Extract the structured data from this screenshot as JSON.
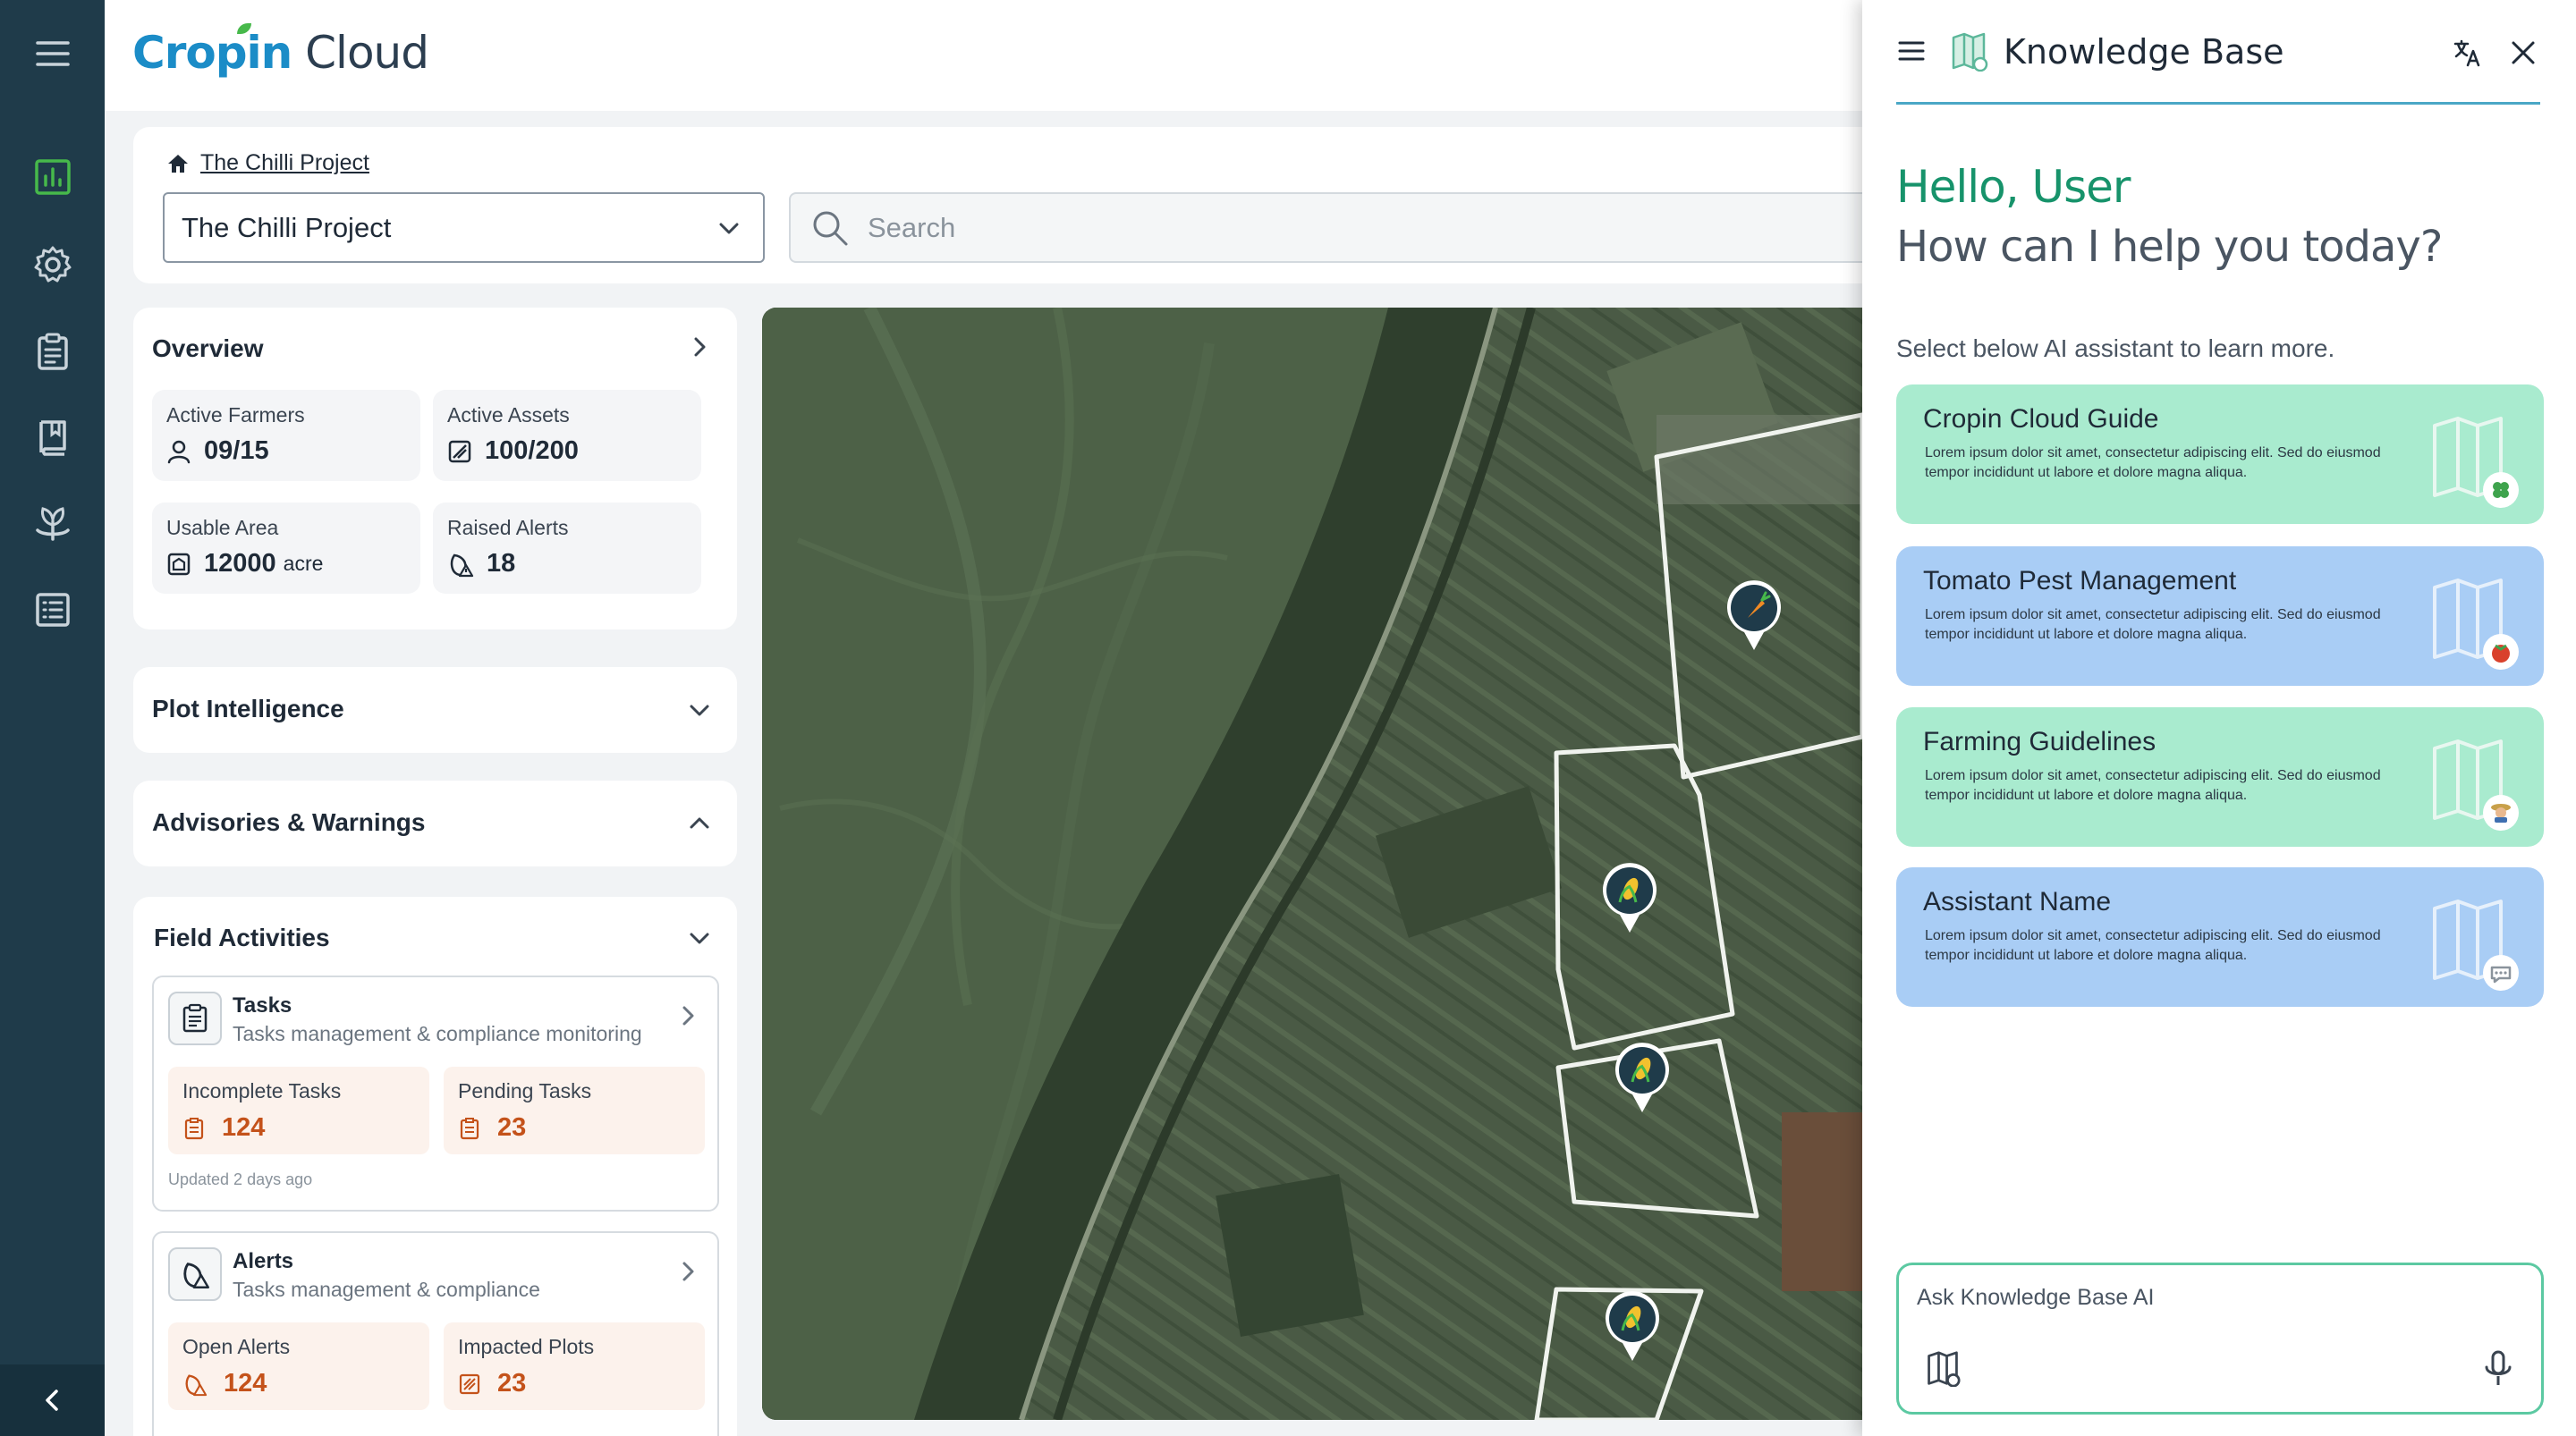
{
  "app": {
    "logo_primary": "Cropin",
    "logo_secondary": "Cloud"
  },
  "rail": {
    "items": [
      {
        "icon": "hamburger-menu-icon"
      },
      {
        "icon": "dashboard-chart-icon",
        "active": true
      },
      {
        "icon": "settings-gear-icon"
      },
      {
        "icon": "clipboard-icon"
      },
      {
        "icon": "book-icon"
      },
      {
        "icon": "plant-icon"
      },
      {
        "icon": "list-icon"
      }
    ],
    "collapse_icon": "chevron-left-icon",
    "colors": {
      "background": "#1f3b4a",
      "active": "#47b94b",
      "icon": "#c9d3da"
    }
  },
  "header": {
    "breadcrumb": "The Chilli Project",
    "project_select": "The Chilli Project",
    "search_placeholder": "Search"
  },
  "overview": {
    "title": "Overview",
    "stats": [
      {
        "label": "Active Farmers",
        "value": "09/15",
        "icon": "person-icon"
      },
      {
        "label": "Active Assets",
        "value": "100/200",
        "icon": "asset-icon"
      },
      {
        "label": "Usable Area",
        "value": "12000",
        "unit": "acre",
        "icon": "area-icon"
      },
      {
        "label": "Raised Alerts",
        "value": "18",
        "icon": "alert-leaf-icon"
      }
    ]
  },
  "sections": {
    "plot_intelligence": "Plot Intelligence",
    "advisories": "Advisories & Warnings",
    "field_activities": "Field Activities"
  },
  "activities": [
    {
      "title": "Tasks",
      "subtitle": "Tasks management & compliance monitoring",
      "metrics": [
        {
          "label": "Incomplete Tasks",
          "value": "124"
        },
        {
          "label": "Pending Tasks",
          "value": "23"
        }
      ],
      "updated": "Updated 2 days ago"
    },
    {
      "title": "Alerts",
      "subtitle": "Tasks management & compliance",
      "metrics": [
        {
          "label": "Open Alerts",
          "value": "124"
        },
        {
          "label": "Impacted Plots",
          "value": "23"
        }
      ]
    }
  ],
  "map": {
    "markers": [
      {
        "crop": "carrot"
      },
      {
        "crop": "corn"
      },
      {
        "crop": "corn"
      },
      {
        "crop": "corn"
      }
    ]
  },
  "kb": {
    "title": "Knowledge Base",
    "hello": "Hello, User",
    "help": "How can I help you today?",
    "select_text": "Select below AI assistant to learn more.",
    "assistants": [
      {
        "name": "Cropin Cloud Guide",
        "desc": "Lorem ipsum dolor sit amet, consectetur adipiscing elit. Sed do eiusmod tempor incididunt ut labore et dolore magna aliqua.",
        "color": "#a9ebcf",
        "badge": "clover-icon"
      },
      {
        "name": "Tomato Pest Management",
        "desc": "Lorem ipsum dolor sit amet, consectetur adipiscing elit. Sed do eiusmod tempor incididunt ut labore et dolore magna aliqua.",
        "color": "#a9cdf5",
        "badge": "tomato-icon"
      },
      {
        "name": "Farming Guidelines",
        "desc": "Lorem ipsum dolor sit amet, consectetur adipiscing elit. Sed do eiusmod tempor incididunt ut labore et dolore magna aliqua.",
        "color": "#a9ebcf",
        "badge": "farmer-icon"
      },
      {
        "name": "Assistant Name",
        "desc": "Lorem ipsum dolor sit amet, consectetur adipiscing elit. Sed do eiusmod tempor incididunt ut labore et dolore magna aliqua.",
        "color": "#a9cdf5",
        "badge": "chat-bubble-icon"
      }
    ],
    "ask_placeholder": "Ask Knowledge Base AI",
    "colors": {
      "hello": "#17936b",
      "accent_line": "#4aa7c6",
      "input_border": "#5cc9a2"
    }
  },
  "colors": {
    "metric_value": "#c4521a",
    "metric_bg": "#fcf2ec",
    "brand_blue": "#1b8cc7"
  }
}
